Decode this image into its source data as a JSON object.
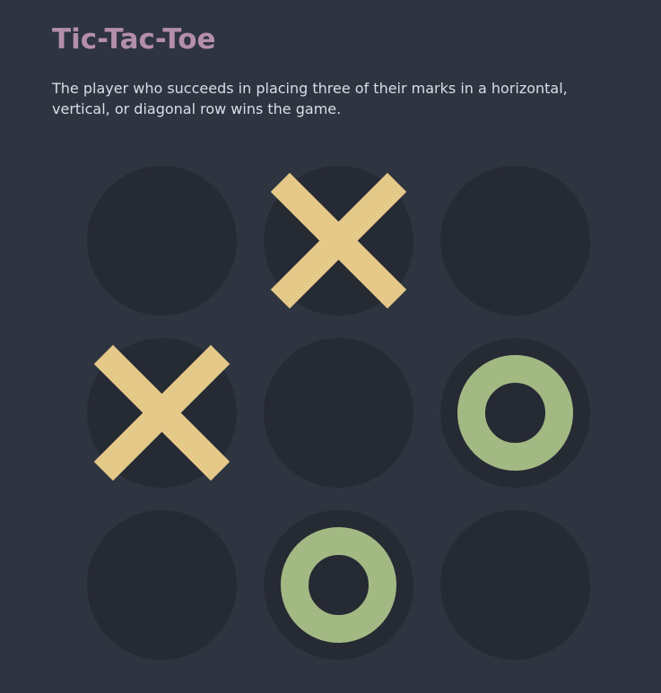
{
  "title": "Tic-Tac-Toe",
  "description": "The player who succeeds in placing three of their marks in a horizontal, vertical, or diagonal row wins the game.",
  "colors": {
    "background": "#2e3440",
    "cell": "#262a33",
    "title": "#b48ead",
    "text": "#d8dee9",
    "x_mark": "#e5c989",
    "o_mark": "#a3b984"
  },
  "board": [
    [
      "",
      "X",
      ""
    ],
    [
      "X",
      "",
      "O"
    ],
    [
      "",
      "O",
      ""
    ]
  ]
}
